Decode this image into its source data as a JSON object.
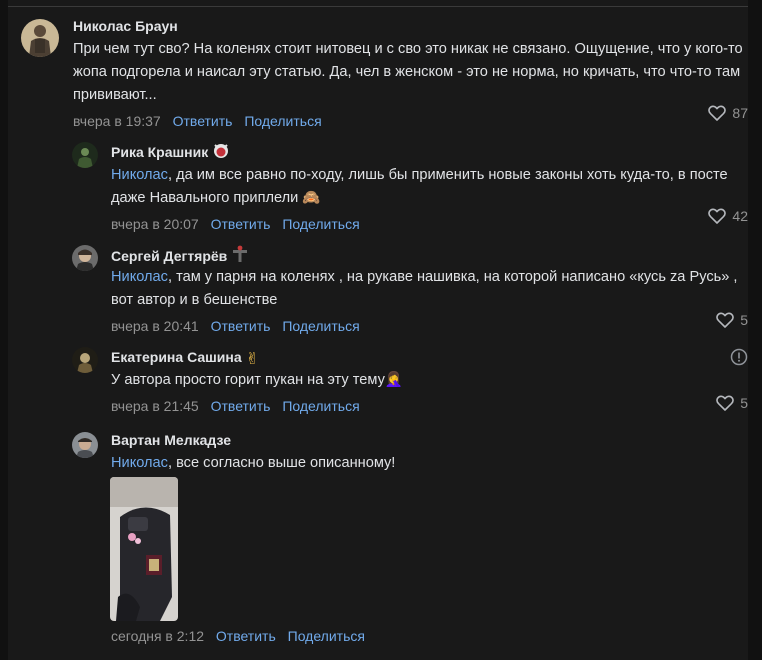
{
  "comments": [
    {
      "author": "Николас Браун",
      "text": "При чем тут сво? На коленях стоит нитовец и с сво это никак не связано. Ощущение, что у кого-то жопа подгорела и наисал эту статью. Да, чел в женском - это не норма, но кричать, что что-то там прививают...",
      "time": "вчера в 19:37",
      "reply_label": "Ответить",
      "share_label": "Поделиться",
      "likes": "87"
    },
    {
      "author": "Рика Крашник",
      "mention": "Николас",
      "text": ", да им все равно по-ходу, лишь бы применить новые законы хоть куда-то, в посте даже Навального приплели 🙈",
      "time": "вчера в 20:07",
      "reply_label": "Ответить",
      "share_label": "Поделиться",
      "likes": "42"
    },
    {
      "author": "Сергей Дегтярёв",
      "mention": "Николас",
      "text": ", там у парня на коленях , на рукаве нашивка, на которой написано «кусь za Русь» , вот автор и в бешенстве",
      "time": "вчера в 20:41",
      "reply_label": "Ответить",
      "share_label": "Поделиться",
      "likes": "5"
    },
    {
      "author": "Екатерина Сашина",
      "author_emoji": "✌",
      "text": "У автора просто горит пукан на эту тему🤦‍♀️",
      "time": "вчера в 21:45",
      "reply_label": "Ответить",
      "share_label": "Поделиться",
      "likes": "5"
    },
    {
      "author": "Вартан Мелкадзе",
      "mention": "Николас",
      "text": ", все согласно выше описанному!",
      "time": "сегодня в 2:12",
      "reply_label": "Ответить",
      "share_label": "Поделиться"
    }
  ],
  "colors": {
    "background": "#191919",
    "text": "#e1e3e6",
    "link": "#71aaeb",
    "secondary": "#939393"
  }
}
